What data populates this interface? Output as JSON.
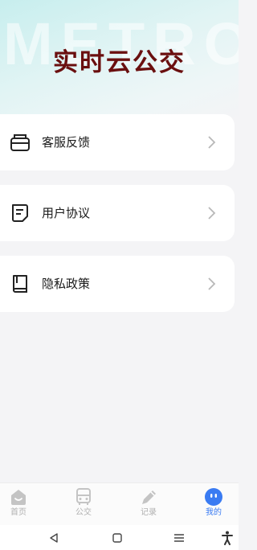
{
  "header": {
    "watermark": "METRO",
    "title": "实时云公交"
  },
  "menu": [
    {
      "label": "客服反馈",
      "icon": "customer-service-icon"
    },
    {
      "label": "用户协议",
      "icon": "agreement-document-icon"
    },
    {
      "label": "隐私政策",
      "icon": "privacy-book-icon"
    }
  ],
  "tabs": [
    {
      "label": "首页",
      "icon": "home-icon",
      "active": false
    },
    {
      "label": "公交",
      "icon": "bus-icon",
      "active": false
    },
    {
      "label": "记录",
      "icon": "pencil-icon",
      "active": false
    },
    {
      "label": "我的",
      "icon": "profile-face-icon",
      "active": true
    }
  ],
  "system_nav": {
    "icons": [
      "back-icon",
      "home-square-icon",
      "recents-menu-icon",
      "accessibility-icon"
    ]
  },
  "colors": {
    "title": "#6a0f0f",
    "accent": "#3a7bf2",
    "tab_inactive": "#b0b0b0",
    "background": "#f4f4f6",
    "card": "#ffffff"
  }
}
